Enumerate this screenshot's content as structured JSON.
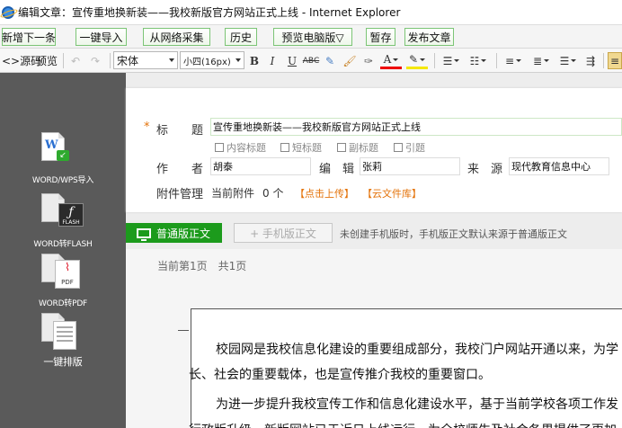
{
  "window": {
    "title": "编辑文章：宣传重地换新装——我校新版官方网站正式上线 - Internet Explorer"
  },
  "toolbar": {
    "buttons": [
      "新增下一条",
      "一键导入",
      "从网络采集",
      "历史",
      "预览电脑版▽",
      "暂存",
      "发布文章"
    ]
  },
  "editor_toolbar": {
    "source_label": "<>源码",
    "preview_label": "预览",
    "font_family": "宋体",
    "font_size": "小四(16px)"
  },
  "sidebar": {
    "items": [
      {
        "label": "WORD/WPS导入",
        "icon": "word-icon"
      },
      {
        "label": "WORD转FLASH",
        "icon": "flash-icon"
      },
      {
        "label": "WORD转PDF",
        "icon": "pdf-icon"
      },
      {
        "label": "一键排版",
        "icon": "layout-icon"
      }
    ]
  },
  "form": {
    "required_mark": "*",
    "title_label": "标　　题",
    "title_value": "宣传重地换新装——我校新版官方网站正式上线",
    "checkboxes": [
      "内容标题",
      "短标题",
      "副标题",
      "引题"
    ],
    "author_label": "作　　者",
    "author_value": "胡泰",
    "editor_label": "编　辑",
    "editor_value": "张莉",
    "source_label": "来　源",
    "source_value": "现代教育信息中心",
    "attach_label": "附件管理",
    "attach_current": "当前附件",
    "attach_count": "0 个",
    "upload_link": "【点击上传】",
    "cloud_link": "【云文件库】"
  },
  "tabs": {
    "normal_label": "普通版正文",
    "mobile_label": "+ 手机版正文",
    "note": "未创建手机版时，手机版正文默认来源于普通版正文"
  },
  "document": {
    "page_info": "当前第1页　共1页",
    "paragraphs": [
      "校园网是我校信息化建设的重要组成部分，我校门户网站开通以来，为学",
      "长、社会的重要载体，也是宣传推介我校的重要窗口。",
      "为进一步提升我校宣传工作和信息化建设水平，基于当前学校各项工作发",
      "行政版升级，新版网站已于近日上线运行，为全校师生及社会各界提供了更加"
    ]
  },
  "colors": {
    "accent_green": "#1c9b1c",
    "link_orange": "#e4730a",
    "sidebar_bg": "#5a5a5a",
    "required_red": "#e4730a"
  }
}
